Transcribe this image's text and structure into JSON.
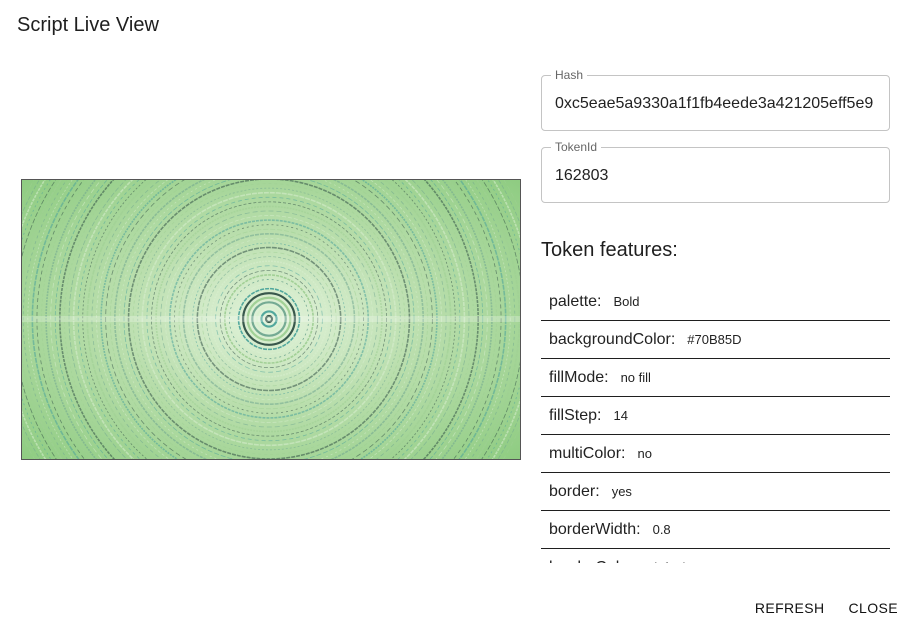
{
  "dialog": {
    "title": "Script Live View"
  },
  "hash_field": {
    "label": "Hash",
    "value": "0xc5eae5a9330a1f1fb4eede3a421205eff5e9"
  },
  "token_field": {
    "label": "TokenId",
    "value": "162803"
  },
  "features": {
    "heading": "Token features:",
    "items": [
      {
        "key": "palette:",
        "value": "Bold"
      },
      {
        "key": "backgroundColor:",
        "value": "#70B85D"
      },
      {
        "key": "fillMode:",
        "value": "no fill"
      },
      {
        "key": "fillStep:",
        "value": "14"
      },
      {
        "key": "multiColor:",
        "value": "no"
      },
      {
        "key": "border:",
        "value": "yes"
      },
      {
        "key": "borderWidth:",
        "value": "0.8"
      },
      {
        "key": "borderColor:",
        "value": "default"
      }
    ]
  },
  "actions": {
    "refresh_label": "REFRESH",
    "close_label": "CLOSE"
  },
  "colors": {
    "background": "#70B85D",
    "ring_dark": "#2f4f45",
    "ring_teal": "#4aa39a",
    "ring_light": "#d8efd0"
  }
}
